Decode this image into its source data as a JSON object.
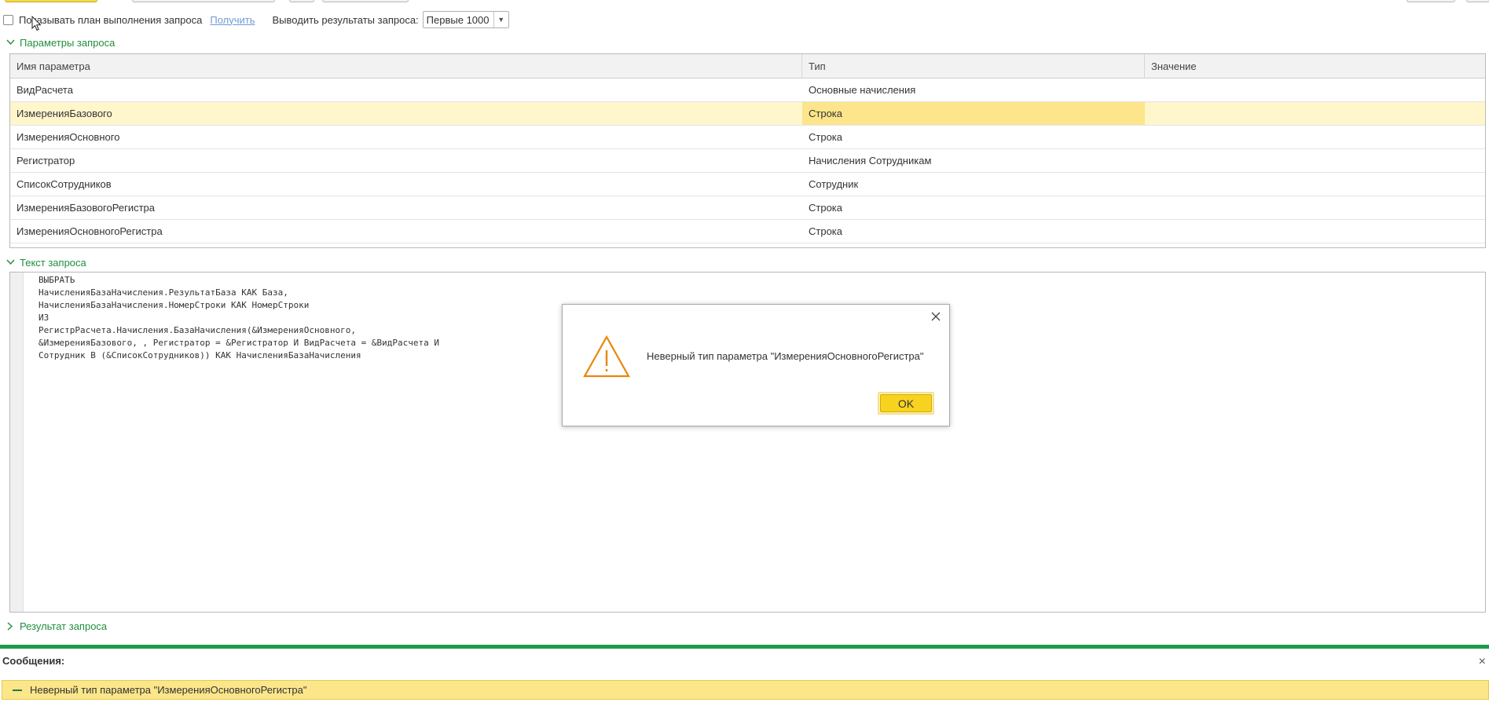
{
  "top": {
    "show_plan_label": "Показывать план выполнения запроса",
    "get_link": "Получить",
    "output_label": "Выводить результаты запроса:",
    "output_value": "Первые 1000"
  },
  "params_section": {
    "title": "Параметры запроса"
  },
  "params_table": {
    "headers": [
      "Имя параметра",
      "Тип",
      "Значение"
    ],
    "rows": [
      {
        "name": "ВидРасчета",
        "type": "Основные начисления",
        "value": ""
      },
      {
        "name": "ИзмеренияБазового",
        "type": "Строка",
        "value": ""
      },
      {
        "name": "ИзмеренияОсновного",
        "type": "Строка",
        "value": ""
      },
      {
        "name": "Регистратор",
        "type": "Начисления Сотрудникам",
        "value": ""
      },
      {
        "name": "СписокСотрудников",
        "type": "Сотрудник",
        "value": ""
      },
      {
        "name": "ИзмеренияБазовогоРегистра",
        "type": "Строка",
        "value": ""
      },
      {
        "name": "ИзмеренияОсновногоРегистра",
        "type": "Строка",
        "value": ""
      }
    ]
  },
  "query_section": {
    "title": "Текст запроса"
  },
  "query_text": "ВЫБРАТЬ\nНачисленияБазаНачисления.РезультатБаза КАК База,\nНачисленияБазаНачисления.НомерСтроки КАК НомерСтроки\nИЗ\nРегистрРасчета.Начисления.БазаНачисления(&ИзмеренияОсновного,\n&ИзмеренияБазового, , Регистратор = &Регистратор И ВидРасчета = &ВидРасчета И\nСотрудник В (&СписокСотрудников)) КАК НачисленияБазаНачисления",
  "dialog": {
    "message": "Неверный тип параметра \"ИзмеренияОсновногоРегистра\"",
    "ok_label": "OK"
  },
  "result_section": {
    "title": "Результат запроса"
  },
  "messages": {
    "title": "Сообщения:",
    "items": [
      "Неверный тип параметра \"ИзмеренияОсновногоРегистра\""
    ]
  },
  "colors": {
    "section_green": "#1f8f3b",
    "selected_row": "#fff6cc",
    "selected_cell": "#fde58b",
    "ok_button": "#f7d320",
    "warning_orange": "#e8870a",
    "message_bg": "#fbe68a"
  }
}
